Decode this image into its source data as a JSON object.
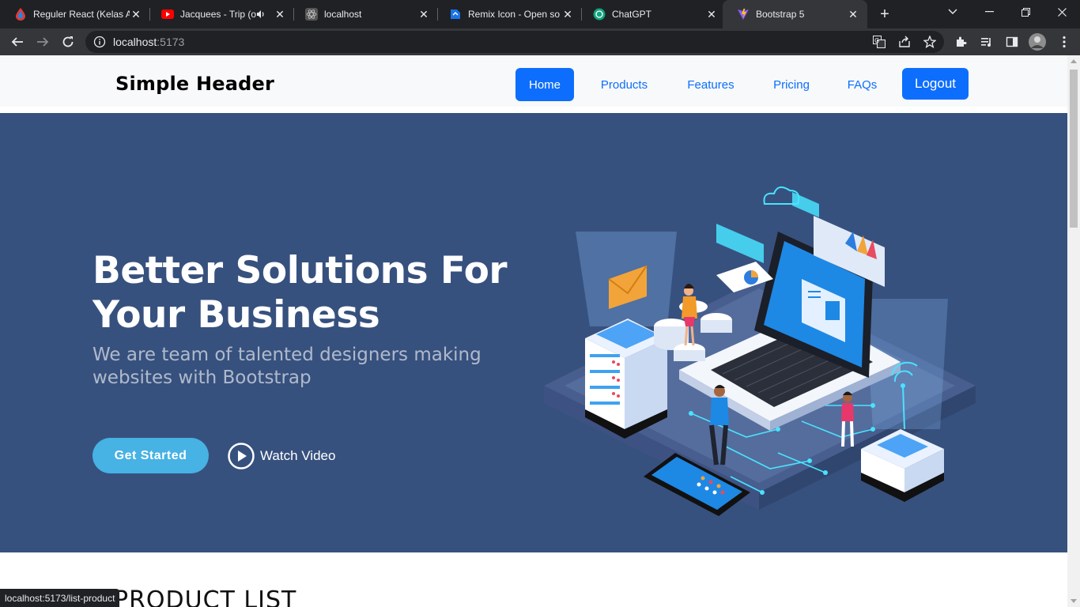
{
  "browser": {
    "tabs": [
      {
        "title": "Reguler React (Kelas A",
        "favicon": "drop-icon",
        "color": "#e53935"
      },
      {
        "title": "Jacquees - Trip (of",
        "favicon": "youtube-icon",
        "color": "#ff0000",
        "audio": true
      },
      {
        "title": "localhost",
        "favicon": "react-icon",
        "color": "#888888"
      },
      {
        "title": "Remix Icon - Open so",
        "favicon": "remix-icon",
        "color": "#1a73e8"
      },
      {
        "title": "ChatGPT",
        "favicon": "chatgpt-icon",
        "color": "#10a37f"
      },
      {
        "title": "Bootstrap 5",
        "favicon": "vite-icon",
        "color": "#bd34fe",
        "active": true
      }
    ],
    "url_host": "localhost",
    "url_port": ":5173",
    "status_url": "localhost:5173/list-product"
  },
  "navbar": {
    "brand": "Simple Header",
    "links": [
      {
        "label": "Home",
        "active": true
      },
      {
        "label": "Products"
      },
      {
        "label": "Features"
      },
      {
        "label": "Pricing"
      },
      {
        "label": "FAQs"
      }
    ],
    "logout_label": "Logout"
  },
  "hero": {
    "title": "Better Solutions For Your Business",
    "subtitle": "We are team of talented designers making websites with Bootstrap",
    "cta_label": "Get Started",
    "video_label": "Watch Video"
  },
  "section": {
    "title": "PRODUCT LIST"
  },
  "colors": {
    "hero_bg": "#37517e",
    "primary": "#0d6efd",
    "accent": "#47b2e4"
  }
}
